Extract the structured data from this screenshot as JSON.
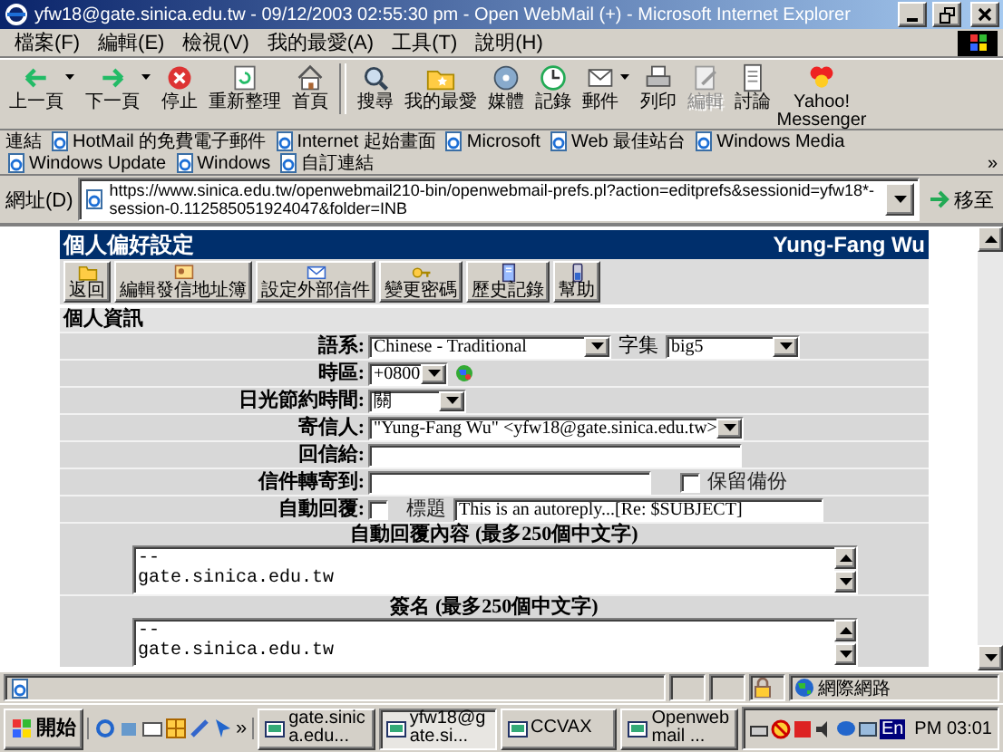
{
  "window": {
    "title": "yfw18@gate.sinica.edu.tw - 09/12/2003 02:55:30 pm - Open WebMail (+) - Microsoft Internet Explorer"
  },
  "menu": [
    "檔案(F)",
    "編輯(E)",
    "檢視(V)",
    "我的最愛(A)",
    "工具(T)",
    "說明(H)"
  ],
  "toolbar": [
    {
      "label": "上一頁",
      "dropdown": true,
      "disabled": false
    },
    {
      "label": "下一頁",
      "dropdown": true,
      "disabled": false
    },
    {
      "label": "停止",
      "dropdown": false,
      "disabled": false
    },
    {
      "label": "重新整理",
      "dropdown": false,
      "disabled": false
    },
    {
      "label": "首頁",
      "dropdown": false,
      "disabled": false
    },
    {
      "label": "搜尋",
      "dropdown": false,
      "disabled": false
    },
    {
      "label": "我的最愛",
      "dropdown": false,
      "disabled": false
    },
    {
      "label": "媒體",
      "dropdown": false,
      "disabled": false
    },
    {
      "label": "記錄",
      "dropdown": false,
      "disabled": false
    },
    {
      "label": "郵件",
      "dropdown": true,
      "disabled": false
    },
    {
      "label": "列印",
      "dropdown": false,
      "disabled": false
    },
    {
      "label": "編輯",
      "dropdown": false,
      "disabled": true
    },
    {
      "label": "討論",
      "dropdown": false,
      "disabled": false
    },
    {
      "label": "Yahoo! Messenger",
      "dropdown": false,
      "disabled": false
    }
  ],
  "links": {
    "label": "連結",
    "items": [
      "HotMail 的免費電子郵件",
      "Internet 起始畫面",
      "Microsoft",
      "Web 最佳站台",
      "Windows Media",
      "Windows Update",
      "Windows",
      "自訂連結"
    ],
    "more": "»"
  },
  "address": {
    "label": "網址(D)",
    "value": "https://www.sinica.edu.tw/openwebmail210-bin/openwebmail-prefs.pl?action=editprefs&sessionid=yfw18*-session-0.112585051924047&folder=INB",
    "go": "移至"
  },
  "page": {
    "title": "個人偏好設定",
    "user": "Yung-Fang Wu",
    "buttons": [
      "返回",
      "編輯發信地址簿",
      "設定外部信件",
      "變更密碼",
      "歷史記錄",
      "幫助"
    ],
    "section": "個人資訊",
    "fields": [
      {
        "kind": "select_pair",
        "label": "語系:",
        "value": "Chinese - Traditional",
        "label2": "字集",
        "value2": "big5"
      },
      {
        "kind": "select_icon",
        "label": "時區:",
        "value": "+0800"
      },
      {
        "kind": "select",
        "label": "日光節約時間:",
        "value": "關"
      },
      {
        "kind": "select",
        "label": "寄信人:",
        "value": "\"Yung-Fang Wu\" <yfw18@gate.sinica.edu.tw>"
      },
      {
        "kind": "text",
        "label": "回信給:"
      },
      {
        "kind": "text_check",
        "label": "信件轉寄到:",
        "check_label": "保留備份",
        "checked": false
      },
      {
        "kind": "autoreply",
        "label": "自動回覆:",
        "checked": false,
        "subject_label": "標題",
        "subject": "This is an autoreply...[Re: $SUBJECT]"
      }
    ],
    "text_areas": [
      {
        "heading": "自動回覆內容 (最多250個中文字)",
        "text": "--\ngate.sinica.edu.tw"
      },
      {
        "heading": "簽名 (最多250個中文字)",
        "text": "--\ngate.sinica.edu.tw"
      }
    ]
  },
  "status": {
    "secure": true,
    "zone": "網際網路"
  },
  "taskbar": {
    "start": "開始",
    "quick_more": "»",
    "tasks": [
      {
        "label": "gate.sinica.edu...",
        "selected": false
      },
      {
        "label": "yfw18@gate.si...",
        "selected": true
      },
      {
        "label": "CCVAX",
        "selected": false
      },
      {
        "label": "Openwebmail ...",
        "selected": false
      }
    ],
    "language": "En",
    "clock": "PM 03:01"
  }
}
